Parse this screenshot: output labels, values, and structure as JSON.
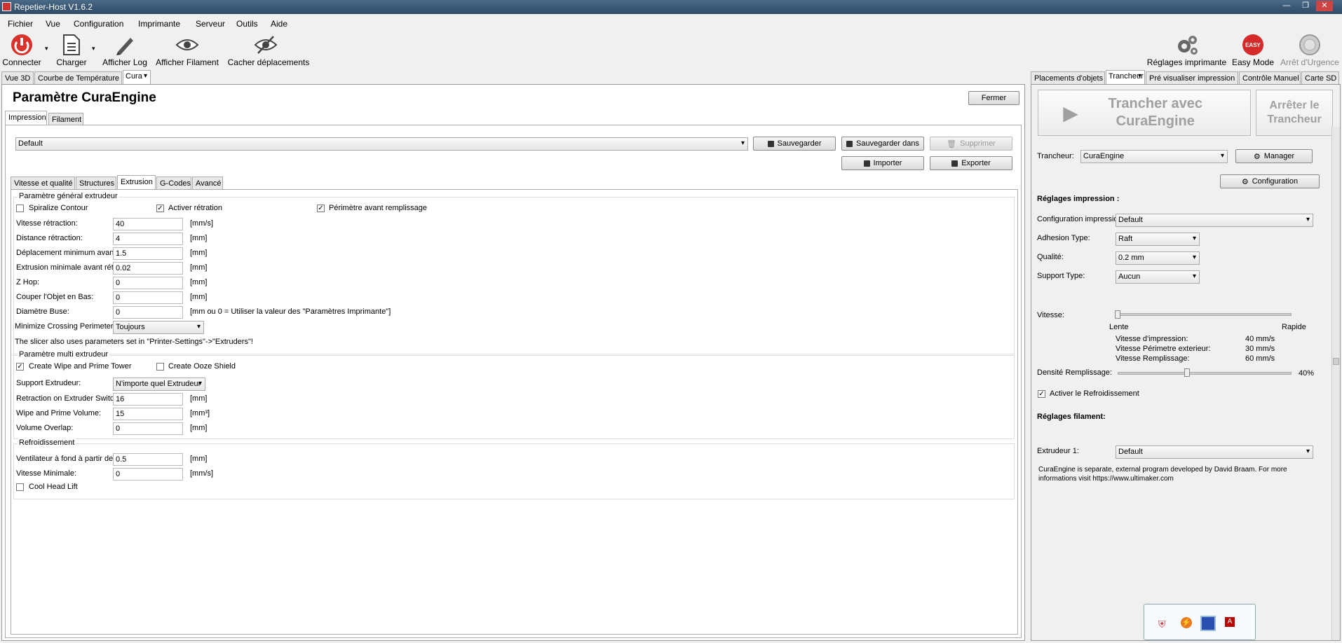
{
  "window": {
    "title": "Repetier-Host V1.6.2",
    "min": "—",
    "max": "❐",
    "close": "✕"
  },
  "menu": [
    "Fichier",
    "Vue",
    "Configuration",
    "Imprimante",
    "Serveur",
    "Outils",
    "Aide"
  ],
  "toolbar": {
    "connect": "Connecter",
    "load": "Charger",
    "showlog": "Afficher Log",
    "showfilament": "Afficher Filament",
    "hidemoves": "Cacher  déplacements",
    "printer_settings": "Réglages imprimante",
    "easy_mode": "Easy Mode",
    "easy_badge": "EASY",
    "emergency": "Arrêt d'Urgence"
  },
  "left_tabs": [
    "Vue 3D",
    "Courbe de Température",
    "Cura"
  ],
  "cura": {
    "title": "Paramètre CuraEngine",
    "close": "Fermer",
    "subtabs": [
      "Impression",
      "Filament"
    ],
    "profile": "Default",
    "save": "Sauvegarder",
    "save_in": "Sauvegarder dans",
    "delete": "Supprimer",
    "import": "Importer",
    "export": "Exporter",
    "inner_tabs": [
      "Vitesse et qualité",
      "Structures",
      "Extrusion",
      "G-Codes",
      "Avancé"
    ],
    "general": {
      "title": "Paramètre général extrudeur",
      "spiralize": "Spiralize Contour",
      "retraction_enabled": "Activer rétration",
      "perimeter_before_infill": "Périmètre avant remplissage",
      "rows": [
        {
          "label": "Vitesse rétraction:",
          "value": "40",
          "unit": "[mm/s]"
        },
        {
          "label": "Distance rétraction:",
          "value": "4",
          "unit": "[mm]"
        },
        {
          "label": "Déplacement minimum avant rétracti",
          "value": "1.5",
          "unit": "[mm]"
        },
        {
          "label": "Extrusion minimale avant rétraction:",
          "value": "0.02",
          "unit": "[mm]"
        },
        {
          "label": "Z Hop:",
          "value": "0",
          "unit": "[mm]"
        },
        {
          "label": "Couper l'Objet en Bas:",
          "value": "0",
          "unit": "[mm]"
        },
        {
          "label": "Diamètre Buse:",
          "value": "0",
          "unit": "[mm ou 0 = Utiliser la valeur des \"Paramètres Imprimante\"]"
        }
      ],
      "crossing_label": "Minimize Crossing Perimeters:",
      "crossing_value": "Toujours",
      "note": "The slicer also uses parameters set in \"Printer-Settings\"->\"Extruders\"!"
    },
    "multi": {
      "title": "Paramètre multi extrudeur",
      "wipe_tower": "Create Wipe and Prime Tower",
      "ooze": "Create Ooze Shield",
      "support_label": "Support Extrudeur:",
      "support_value": "N'importe quel Extrudeur",
      "rows": [
        {
          "label": "Retraction on Extruder Switch:",
          "value": "16",
          "unit": "[mm]"
        },
        {
          "label": "Wipe and Prime Volume:",
          "value": "15",
          "unit": "[mm³]"
        },
        {
          "label": "Volume Overlap:",
          "value": "0",
          "unit": "[mm]"
        }
      ]
    },
    "cooling": {
      "title": "Refroidissement",
      "rows": [
        {
          "label": "Ventilateur à fond à partir de la haute",
          "value": "0.5",
          "unit": "[mm]"
        },
        {
          "label": "Vitesse Minimale:",
          "value": "0",
          "unit": "[mm/s]"
        }
      ],
      "cool_head_lift": "Cool Head Lift"
    }
  },
  "right_tabs": [
    "Placements d'objets",
    "Trancheur",
    "Pré visualiser impression",
    "Contrôle Manuel",
    "Carte SD"
  ],
  "slicer": {
    "slice_button": "Trancher avec CuraEngine",
    "stop_button": "Arrêter le Trancheur",
    "slicer_label": "Trancheur:",
    "slicer_value": "CuraEngine",
    "manager": "Manager",
    "configuration": "Configuration",
    "print_settings_title": "Réglages impression  :",
    "config_label": "Configuration impression:",
    "config_value": "Default",
    "adhesion_label": "Adhesion Type:",
    "adhesion_value": "Raft",
    "quality_label": "Qualité:",
    "quality_value": "0.2 mm",
    "support_label": "Support Type:",
    "support_value": "Aucun",
    "speed_label": "Vitesse:",
    "slow": "Lente",
    "fast": "Rapide",
    "speed_level": 0.0,
    "speeds": [
      {
        "label": "Vitesse d'impression:",
        "value": "40 mm/s"
      },
      {
        "label": "Vitesse Périmetre exterieur:",
        "value": "30 mm/s"
      },
      {
        "label": "Vitesse Remplissage:",
        "value": "60 mm/s"
      }
    ],
    "density_label": "Densité Remplissage:",
    "density_value": "40%",
    "density_level": 0.4,
    "cooling": "Activer le Refroidissement",
    "filament_title": "Réglages filament:",
    "extruder_label": "Extrudeur 1:",
    "extruder_value": "Default",
    "info": "CuraEngine is separate, external program developed by David Braam. For more informations visit https://www.ultimaker.com"
  }
}
